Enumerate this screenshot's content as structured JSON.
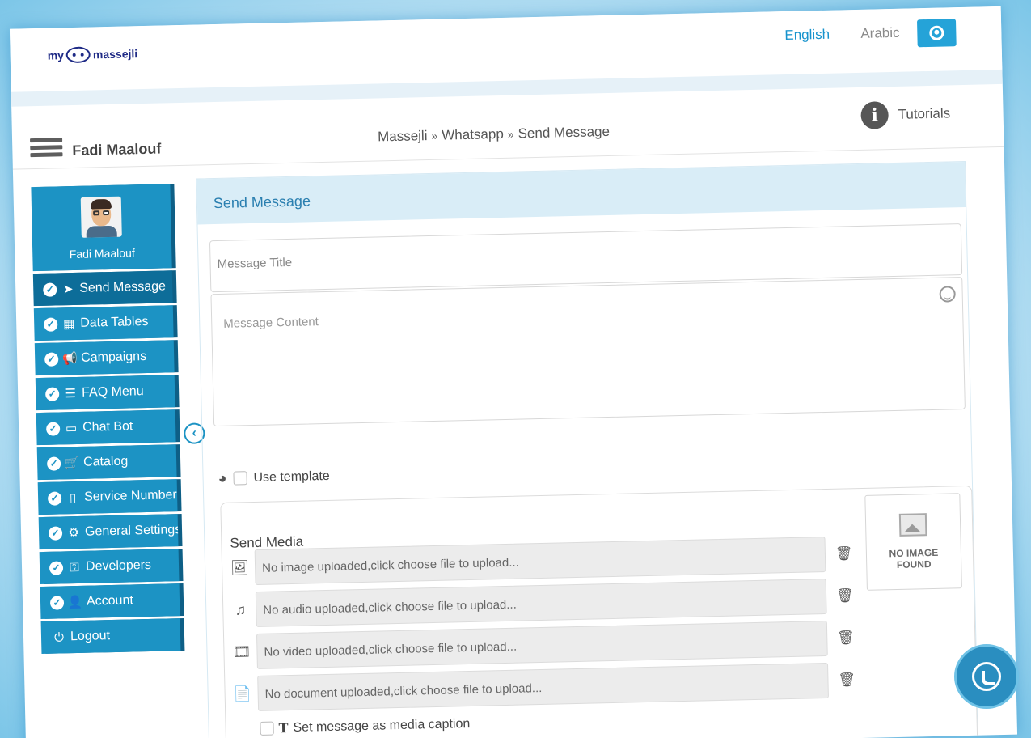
{
  "brand": {
    "logo_left": "my",
    "logo_right": "massejli"
  },
  "topnav": {
    "english": "English",
    "arabic": "Arabic"
  },
  "header": {
    "user_name": "Fadi Maalouf",
    "breadcrumb": [
      "Massejli",
      "Whatsapp",
      "Send Message"
    ],
    "breadcrumb_sep": "»",
    "tutorials": "Tutorials"
  },
  "sidebar": {
    "profile_name": "Fadi Maalouf",
    "items": [
      {
        "label": "Send Message",
        "icon": "paper-plane-icon",
        "glyph": "➤"
      },
      {
        "label": "Data Tables",
        "icon": "table-icon",
        "glyph": "▦"
      },
      {
        "label": "Campaigns",
        "icon": "bullhorn-icon",
        "glyph": "📢"
      },
      {
        "label": "FAQ Menu",
        "icon": "list-icon",
        "glyph": "☰"
      },
      {
        "label": "Chat Bot",
        "icon": "laptop-icon",
        "glyph": "▭"
      },
      {
        "label": "Catalog",
        "icon": "cart-icon",
        "glyph": "🛒"
      },
      {
        "label": "Service Number",
        "icon": "mobile-icon",
        "glyph": "▯"
      },
      {
        "label": "General Settings",
        "icon": "cogs-icon",
        "glyph": "⚙"
      },
      {
        "label": "Developers",
        "icon": "key-icon",
        "glyph": "⚿"
      },
      {
        "label": "Account",
        "icon": "user-icon",
        "glyph": "👤"
      }
    ],
    "logout": {
      "label": "Logout",
      "icon": "power-icon",
      "glyph": "⏻"
    }
  },
  "panel": {
    "title": "Send Message",
    "message_title_placeholder": "Message Title",
    "message_content_placeholder": "Message Content",
    "use_template_label": "Use template",
    "send_media_label": "Send Media",
    "media_rows": [
      {
        "icon": "image-icon",
        "glyph": "🖼",
        "text": "No image uploaded,click choose file to upload..."
      },
      {
        "icon": "music-icon",
        "glyph": "♫",
        "text": "No audio uploaded,click choose file to upload..."
      },
      {
        "icon": "film-icon",
        "glyph": "🎞",
        "text": "No video uploaded,click choose file to upload..."
      },
      {
        "icon": "file-icon",
        "glyph": "📄",
        "text": "No document uploaded,click choose file to upload..."
      }
    ],
    "trash_glyph": "🗑",
    "no_image_line1": "NO IMAGE",
    "no_image_line2": "FOUND",
    "caption_label": "Set message as media caption"
  },
  "colors": {
    "accent": "#1c93c4",
    "accent_dark": "#0e5f86",
    "panel_head_bg": "#d9edf7",
    "link": "#1793cd"
  }
}
